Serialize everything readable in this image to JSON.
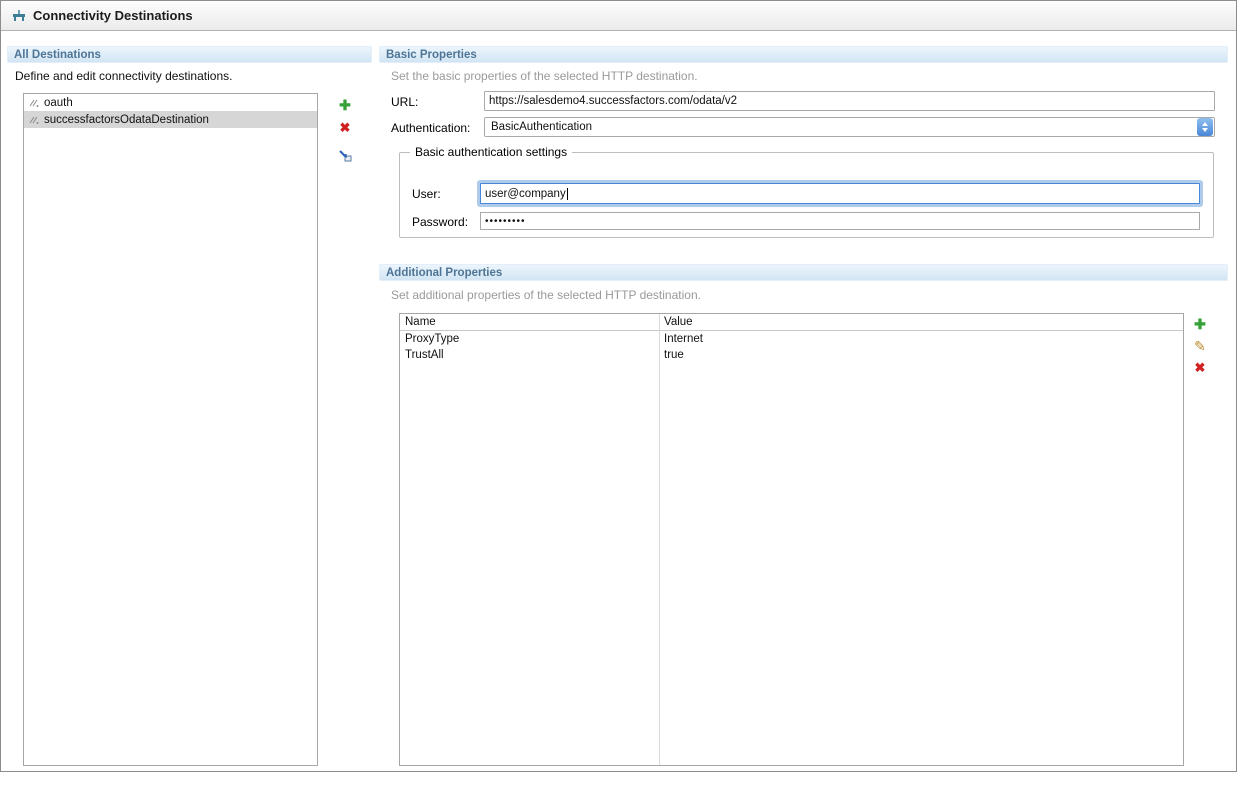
{
  "window": {
    "title": "Connectivity Destinations"
  },
  "all_destinations": {
    "title": "All Destinations",
    "description": "Define and edit connectivity destinations.",
    "items": [
      {
        "label": "oauth"
      },
      {
        "label": "successfactorsOdataDestination"
      }
    ],
    "selected_index": 1
  },
  "basic_properties": {
    "title": "Basic Properties",
    "description": "Set the basic properties of the selected HTTP destination.",
    "fields": {
      "url": {
        "label": "URL:",
        "value": "https://salesdemo4.successfactors.com/odata/v2"
      },
      "authentication": {
        "label": "Authentication:",
        "value": "BasicAuthentication"
      }
    },
    "basic_auth": {
      "title": "Basic authentication settings",
      "user": {
        "label": "User:",
        "value": "user@company"
      },
      "password": {
        "label": "Password:",
        "value": "•••••••••"
      }
    }
  },
  "additional_properties": {
    "title": "Additional Properties",
    "description": "Set additional properties of the selected HTTP destination.",
    "table": {
      "columns": [
        "Name",
        "Value"
      ],
      "rows": [
        {
          "name": "ProxyType",
          "value": "Internet"
        },
        {
          "name": "TrustAll",
          "value": "true"
        }
      ]
    }
  },
  "icons": {
    "add": "✚",
    "delete": "✖",
    "edit": "✎"
  },
  "colors": {
    "section_header_text": "#4e7596",
    "accent_blue": "#4a86d8",
    "add_green": "#35a035",
    "delete_red": "#d02020"
  }
}
